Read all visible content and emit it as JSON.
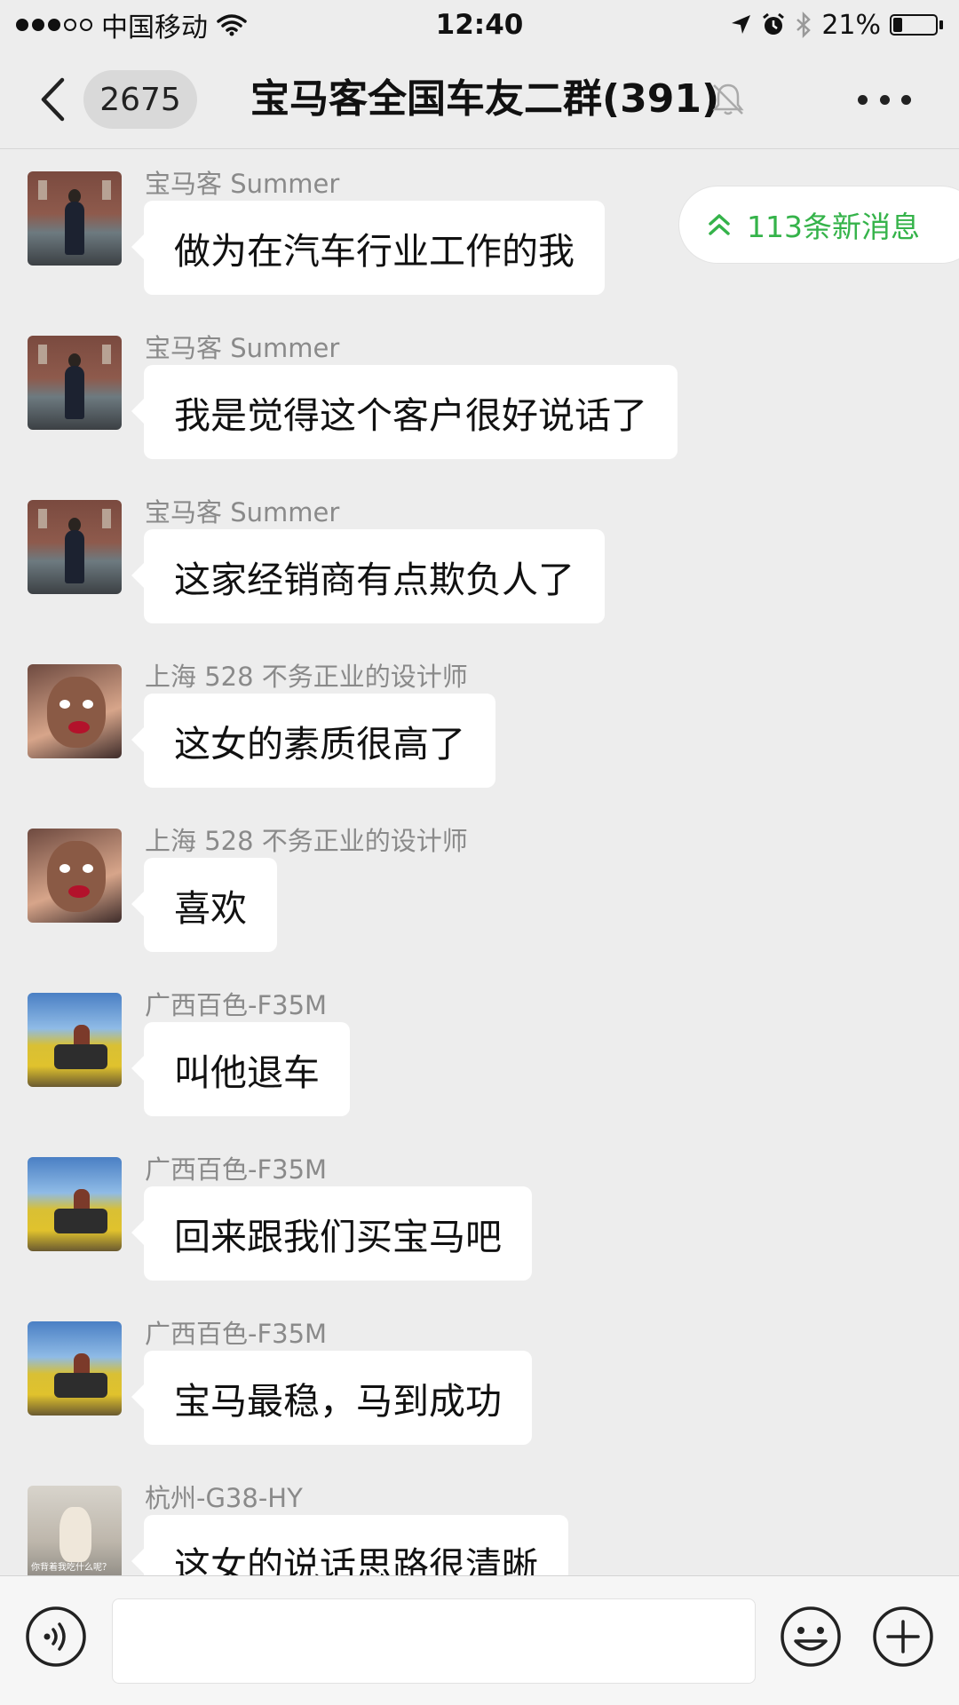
{
  "status_bar": {
    "carrier": "中国移动",
    "time": "12:40",
    "battery_text": "21%",
    "battery_level": 0.21
  },
  "nav": {
    "back_count": "2675",
    "title": "宝马客全国车友二群(391)",
    "icons": [
      "back-chevron-icon",
      "mute-bell-icon",
      "more-icon"
    ]
  },
  "new_messages": {
    "label": "113条新消息",
    "icon": "double-chevron-up-icon",
    "color": "#35b34a"
  },
  "messages": [
    {
      "sender": "宝马客 Summer",
      "text": "做为在汽车行业工作的我",
      "avatar": "suit"
    },
    {
      "sender": "宝马客 Summer",
      "text": "我是觉得这个客户很好说话了",
      "avatar": "suit"
    },
    {
      "sender": "宝马客 Summer",
      "text": "这家经销商有点欺负人了",
      "avatar": "suit"
    },
    {
      "sender": "上海 528  不务正业的设计师",
      "text": "这女的素质很高了",
      "avatar": "girl"
    },
    {
      "sender": "上海 528  不务正业的设计师",
      "text": "喜欢",
      "avatar": "girl"
    },
    {
      "sender": "广西百色-F35M",
      "text": "叫他退车",
      "avatar": "field"
    },
    {
      "sender": "广西百色-F35M",
      "text": "回来跟我们买宝马吧",
      "avatar": "field"
    },
    {
      "sender": "广西百色-F35M",
      "text": "宝马最稳，马到成功",
      "avatar": "field"
    },
    {
      "sender": "杭州-G38-HY",
      "text": "这女的说话思路很清晰",
      "avatar": "cat",
      "avatar_caption": "你背着我吃什么呢？"
    }
  ],
  "input_bar": {
    "icons": [
      "voice-icon",
      "emoji-icon",
      "plus-icon"
    ],
    "value": ""
  }
}
